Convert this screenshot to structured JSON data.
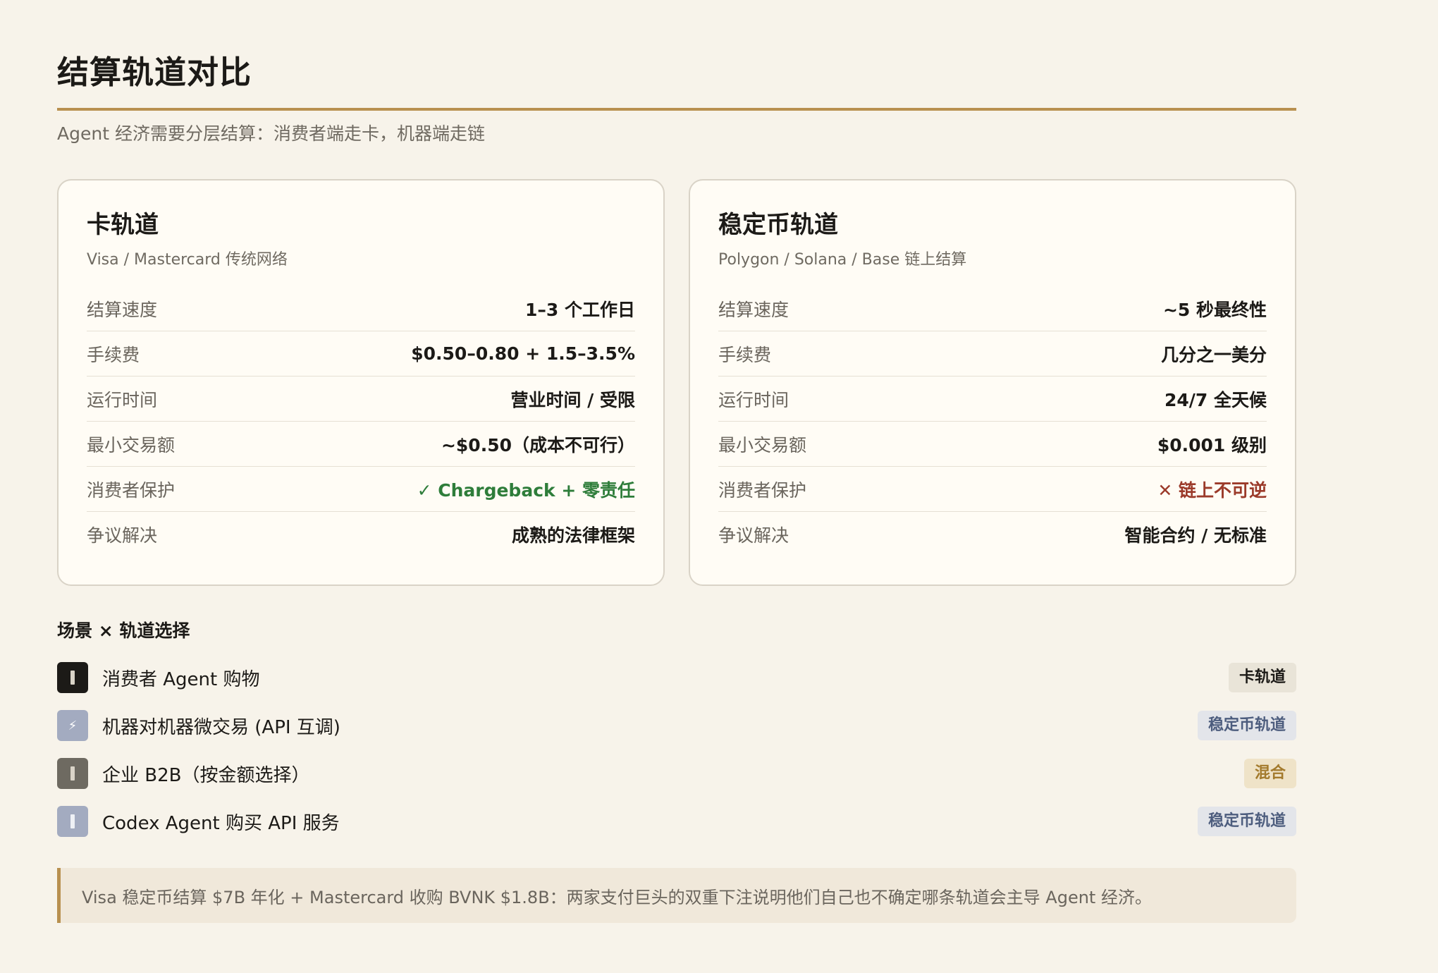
{
  "title": "结算轨道对比",
  "subtitle": "Agent 经济需要分层结算：消费者端走卡，机器端走链",
  "colors": {
    "accent": "#b8904f",
    "good": "#2e7d3a",
    "bad": "#9b3a2a",
    "background": "#f7f3ea"
  },
  "cards": [
    {
      "title": "卡轨道",
      "subtitle": "Visa / Mastercard 传统网络",
      "rows": [
        {
          "label": "结算速度",
          "value": "1–3 个工作日"
        },
        {
          "label": "手续费",
          "value": "$0.50–0.80 + 1.5–3.5%"
        },
        {
          "label": "运行时间",
          "value": "营业时间 / 受限"
        },
        {
          "label": "最小交易额",
          "value": "~$0.50（成本不可行）"
        },
        {
          "label": "消费者保护",
          "value": "✓ Chargeback + 零责任"
        },
        {
          "label": "争议解决",
          "value": "成熟的法律框架"
        }
      ]
    },
    {
      "title": "稳定币轨道",
      "subtitle": "Polygon / Solana / Base 链上结算",
      "rows": [
        {
          "label": "结算速度",
          "value": "~5 秒最终性"
        },
        {
          "label": "手续费",
          "value": "几分之一美分"
        },
        {
          "label": "运行时间",
          "value": "24/7 全天候"
        },
        {
          "label": "最小交易额",
          "value": "$0.001 级别"
        },
        {
          "label": "消费者保护",
          "value": "✕ 链上不可逆"
        },
        {
          "label": "争议解决",
          "value": "智能合约 / 无标准"
        }
      ]
    }
  ],
  "scenarios_title": "场景 × 轨道选择",
  "scenarios": [
    {
      "icon": "shopping-icon",
      "label": "消费者 Agent 购物",
      "tag": "卡轨道",
      "icon_color": "#1c1a17"
    },
    {
      "icon": "lightning-icon",
      "label": "机器对机器微交易 (API 互调)",
      "tag": "稳定币轨道",
      "icon_color": "#a3abc0"
    },
    {
      "icon": "building-icon",
      "label": "企业 B2B（按金额选择）",
      "tag": "混合",
      "icon_color": "#6e6a61"
    },
    {
      "icon": "code-icon",
      "label": "Codex Agent 购买 API 服务",
      "tag": "稳定币轨道",
      "icon_color": "#a3abc0"
    }
  ],
  "note": "Visa 稳定币结算 $7B 年化 + Mastercard 收购 BVNK $1.8B：两家支付巨头的双重下注说明他们自己也不确定哪条轨道会主导 Agent 经济。"
}
